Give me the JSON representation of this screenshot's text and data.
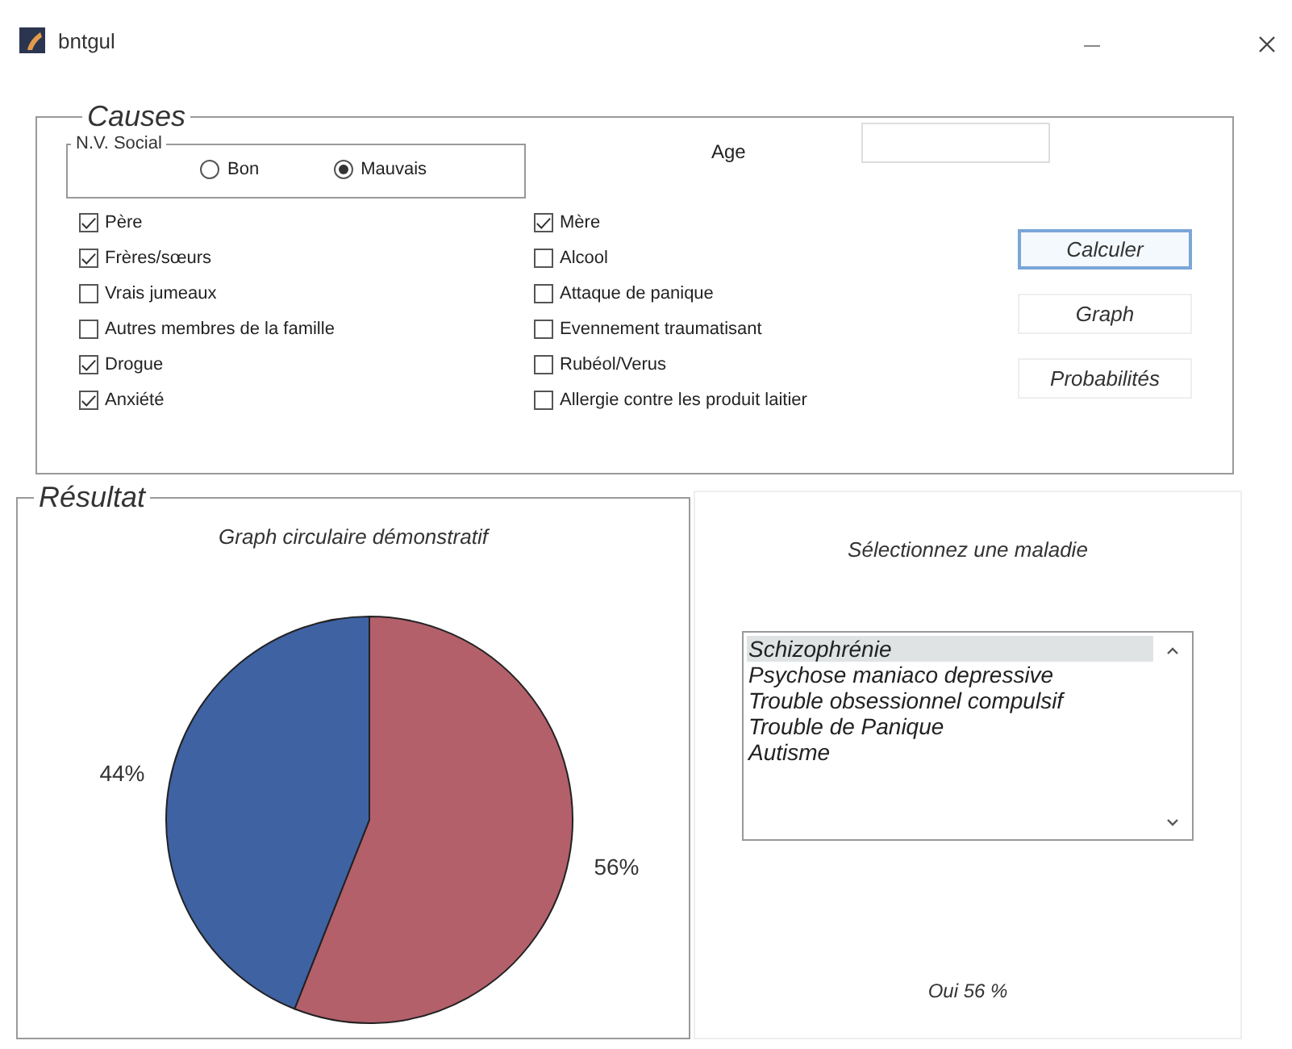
{
  "window": {
    "title": "bntgul"
  },
  "causes": {
    "title": "Causes",
    "social": {
      "title": "N.V. Social",
      "options": [
        {
          "label": "Bon",
          "selected": false
        },
        {
          "label": "Mauvais",
          "selected": true
        }
      ]
    },
    "age": {
      "label": "Age"
    },
    "factors_left": [
      {
        "label": "Père",
        "checked": true
      },
      {
        "label": "Frères/sœurs",
        "checked": true
      },
      {
        "label": "Vrais jumeaux",
        "checked": false
      },
      {
        "label": "Autres membres de la famille",
        "checked": false
      },
      {
        "label": "Drogue",
        "checked": true
      },
      {
        "label": "Anxiété",
        "checked": true
      }
    ],
    "factors_right": [
      {
        "label": "Mère",
        "checked": true
      },
      {
        "label": "Alcool",
        "checked": false
      },
      {
        "label": "Attaque de panique",
        "checked": false
      },
      {
        "label": "Evennement traumatisant",
        "checked": false
      },
      {
        "label": "Rubéol/Verus",
        "checked": false
      },
      {
        "label": "Allergie contre les produit laitier",
        "checked": false
      }
    ],
    "buttons": [
      {
        "label": "Calculer",
        "focused": true
      },
      {
        "label": "Graph",
        "focused": false
      },
      {
        "label": "Probabilités",
        "focused": false
      }
    ]
  },
  "result": {
    "title": "Résultat",
    "chart_title": "Graph circulaire démonstratif",
    "chart_data": {
      "type": "pie",
      "values": [
        56,
        44
      ],
      "value_labels": [
        "56%",
        "44%"
      ]
    }
  },
  "disease_panel": {
    "prompt": "Sélectionnez une maladie",
    "diseases": [
      {
        "label": "Schizophrénie",
        "selected": true
      },
      {
        "label": "Psychose maniaco depressive",
        "selected": false
      },
      {
        "label": "Trouble obsessionnel compulsif",
        "selected": false
      },
      {
        "label": "Trouble de Panique",
        "selected": false
      },
      {
        "label": "Autisme",
        "selected": false
      }
    ],
    "outcome": "Oui 56 %"
  }
}
